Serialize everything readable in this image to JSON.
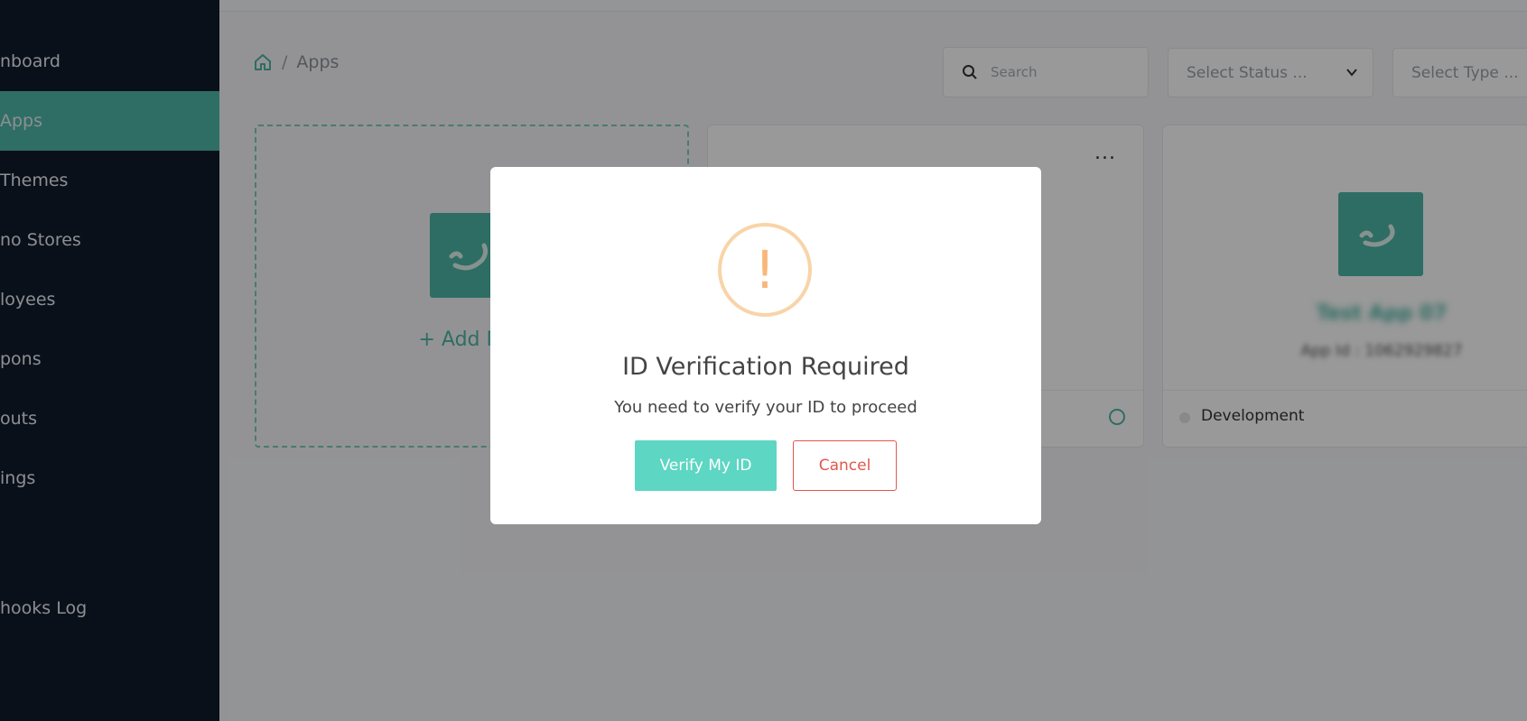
{
  "sidebar": {
    "items": [
      {
        "label": "nboard"
      },
      {
        "label": "Apps"
      },
      {
        "label": "Themes"
      },
      {
        "label": "no Stores"
      },
      {
        "label": "loyees"
      },
      {
        "label": "pons"
      },
      {
        "label": "outs"
      },
      {
        "label": "ings"
      },
      {
        "label": "hooks Log"
      }
    ],
    "active_index": 1
  },
  "breadcrumb": {
    "home_icon": "home-icon",
    "separator": "/",
    "current": "Apps"
  },
  "filters": {
    "search_placeholder": "Search",
    "status_placeholder": "Select Status ...",
    "type_placeholder": "Select Type ..."
  },
  "add_card": {
    "label": "+ Add Nev"
  },
  "app_cards": [
    {
      "menu_label": "...",
      "status": ""
    },
    {
      "name": "Test App 07",
      "app_id": "App Id : 1062929827",
      "status": "Development"
    }
  ],
  "modal": {
    "icon": "!",
    "title": "ID Verification Required",
    "message": "You need to verify your ID to proceed",
    "verify_label": "Verify My ID",
    "cancel_label": "Cancel"
  },
  "colors": {
    "sidebar_bg": "#111b2c",
    "accent": "#4db6a5",
    "verify_button": "#5dd6c3",
    "cancel": "#e2574c",
    "warning": "#f7b87a"
  }
}
